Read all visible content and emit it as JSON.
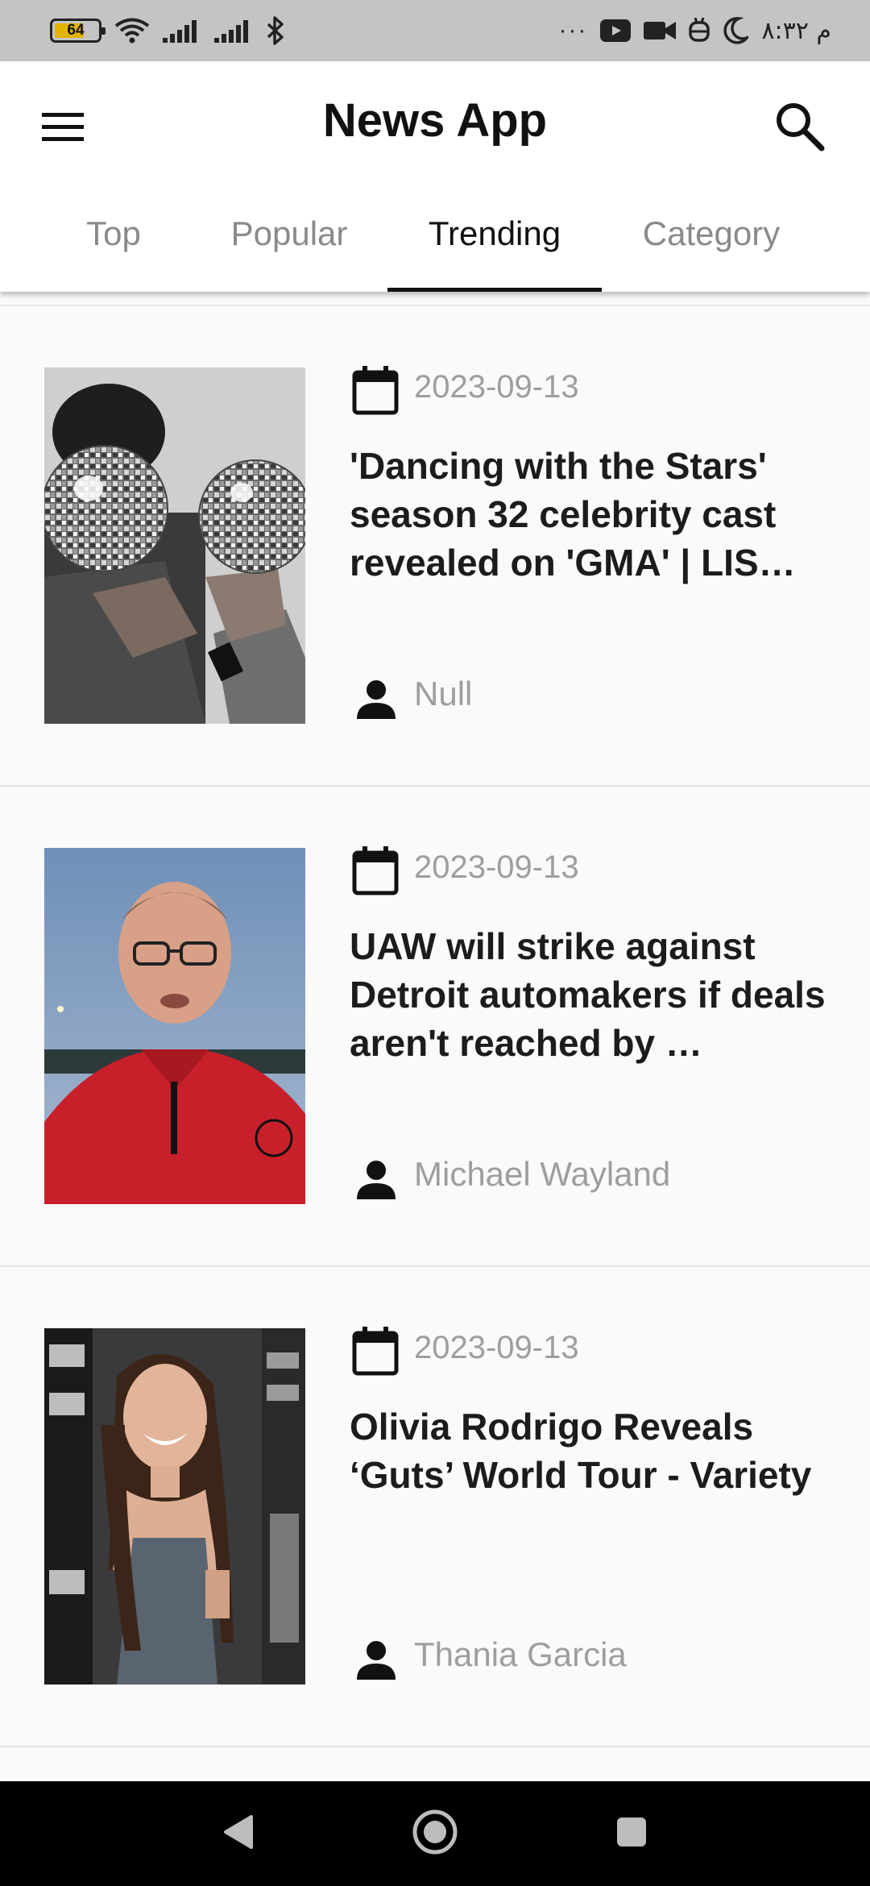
{
  "status_bar": {
    "battery_level": "64",
    "time": "۸:۳۲ م",
    "overflow_dots": "···"
  },
  "app_bar": {
    "title": "News App"
  },
  "tabs": [
    {
      "label": "Top",
      "active": false
    },
    {
      "label": "Popular",
      "active": false
    },
    {
      "label": "Trending",
      "active": true
    },
    {
      "label": "Category",
      "active": false
    }
  ],
  "articles": [
    {
      "date": "2023-09-13",
      "title": "'Dancing with the Stars' season 32 celebrity cast revealed on 'GMA' | LIS…",
      "author": "Null"
    },
    {
      "date": "2023-09-13",
      "title": "UAW will strike against Detroit automakers if deals aren't reached by …",
      "author": "Michael Wayland"
    },
    {
      "date": "2023-09-13",
      "title": "Olivia Rodrigo Reveals ‘Guts’ World Tour - Variety",
      "author": "Thania Garcia"
    }
  ],
  "icons": {
    "menu": "menu-icon",
    "search": "search-icon",
    "calendar": "calendar-icon",
    "person": "person-icon",
    "nav_back": "back-triangle-icon",
    "nav_home": "home-circle-icon",
    "nav_recents": "recents-square-icon"
  },
  "colors": {
    "status_bar_bg": "#c4c4c4",
    "app_bar_bg": "#ffffff",
    "tab_active": "#111111",
    "tab_inactive": "#8a8a8a",
    "meta_text": "#9e9e9e",
    "headline_text": "#1c1c1c",
    "nav_bar_bg": "#000000",
    "battery_fill": "#e3b400"
  }
}
